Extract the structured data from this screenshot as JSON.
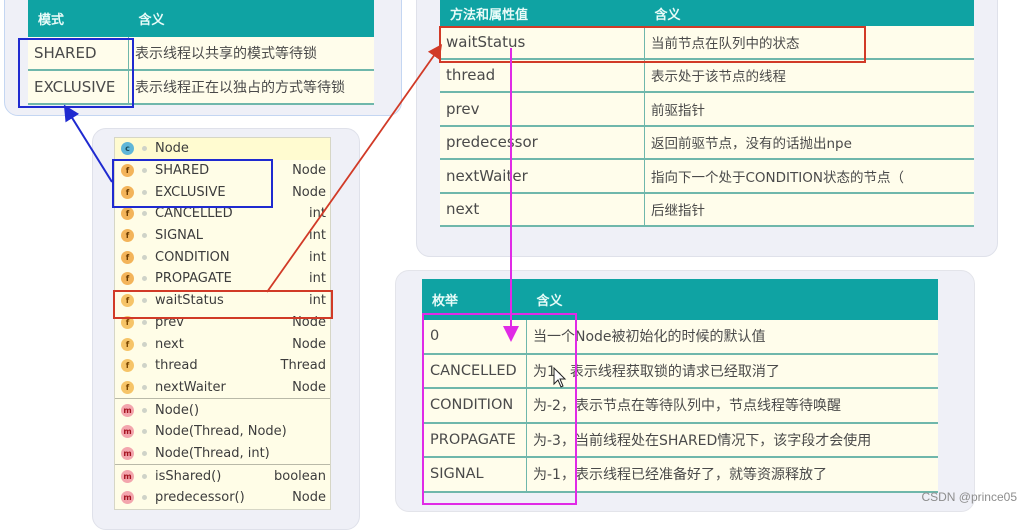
{
  "modes_table": {
    "headers": [
      "模式",
      "含义"
    ],
    "rows": [
      [
        "SHARED",
        "表示线程以共享的模式等待锁"
      ],
      [
        "EXCLUSIVE",
        "表示线程正在以独占的方式等待锁"
      ]
    ]
  },
  "attributes_table": {
    "headers": [
      "方法和属性值",
      "含义"
    ],
    "rows": [
      [
        "waitStatus",
        "当前节点在队列中的状态"
      ],
      [
        "thread",
        "表示处于该节点的线程"
      ],
      [
        "prev",
        "前驱指针"
      ],
      [
        "predecessor",
        "返回前驱节点，没有的话抛出npe"
      ],
      [
        "nextWaiter",
        "指向下一个处于CONDITION状态的节点（"
      ],
      [
        "next",
        "后继指针"
      ]
    ]
  },
  "enum_table": {
    "headers": [
      "枚举",
      "含义"
    ],
    "rows": [
      [
        "0",
        "当一个Node被初始化的时候的默认值"
      ],
      [
        "CANCELLED",
        "为1，表示线程获取锁的请求已经取消了"
      ],
      [
        "CONDITION",
        "为-2，表示节点在等待队列中，节点线程等待唤醒"
      ],
      [
        "PROPAGATE",
        "为-3，当前线程处在SHARED情况下，该字段才会使用"
      ],
      [
        "SIGNAL",
        "为-1，表示线程已经准备好了，就等资源释放了"
      ]
    ]
  },
  "structure": {
    "class_name": "Node",
    "class_icon": "c",
    "members": [
      {
        "icon": "f",
        "kind": "static-final-field",
        "name": "SHARED",
        "type": "Node"
      },
      {
        "icon": "f",
        "kind": "static-final-field",
        "name": "EXCLUSIVE",
        "type": "Node"
      },
      {
        "icon": "f",
        "kind": "static-final-field",
        "name": "CANCELLED",
        "type": "int"
      },
      {
        "icon": "f",
        "kind": "static-final-field",
        "name": "SIGNAL",
        "type": "int"
      },
      {
        "icon": "f",
        "kind": "static-final-field",
        "name": "CONDITION",
        "type": "int"
      },
      {
        "icon": "f",
        "kind": "static-final-field",
        "name": "PROPAGATE",
        "type": "int"
      },
      {
        "icon": "f",
        "kind": "field",
        "name": "waitStatus",
        "type": "int"
      },
      {
        "icon": "f",
        "kind": "field",
        "name": "prev",
        "type": "Node"
      },
      {
        "icon": "f",
        "kind": "field",
        "name": "next",
        "type": "Node"
      },
      {
        "icon": "f",
        "kind": "field",
        "name": "thread",
        "type": "Thread"
      },
      {
        "icon": "f",
        "kind": "field",
        "name": "nextWaiter",
        "type": "Node"
      },
      {
        "icon": "m",
        "kind": "constructor",
        "name": "Node()",
        "type": ""
      },
      {
        "icon": "m",
        "kind": "constructor",
        "name": "Node(Thread, Node)",
        "type": ""
      },
      {
        "icon": "m",
        "kind": "constructor",
        "name": "Node(Thread, int)",
        "type": ""
      },
      {
        "icon": "m",
        "kind": "final-method",
        "name": "isShared()",
        "type": "boolean"
      },
      {
        "icon": "m",
        "kind": "final-method",
        "name": "predecessor()",
        "type": "Node"
      }
    ]
  },
  "annotation_colors": {
    "blue": "#1f2ad0",
    "red": "#d13a27",
    "magenta": "#e02ae6",
    "table_header": "#0fa3a3",
    "table_cell": "#fffdeb"
  },
  "watermark": "CSDN @prince05"
}
